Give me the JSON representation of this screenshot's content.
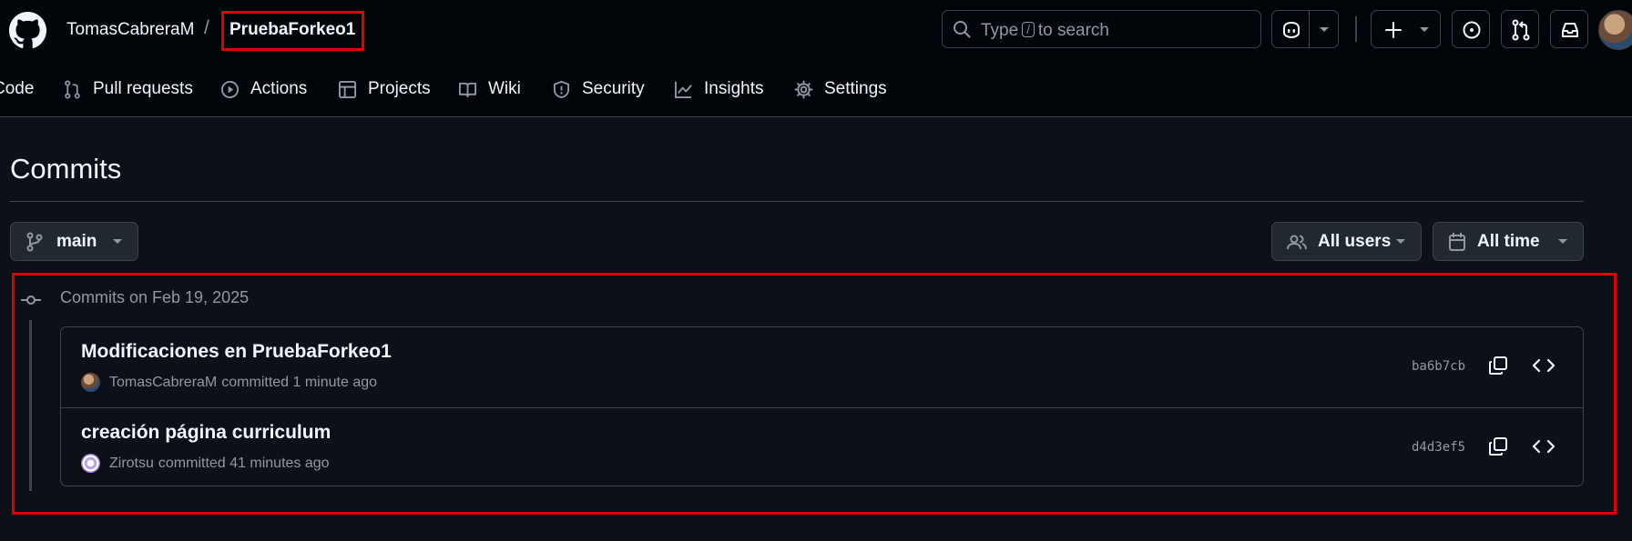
{
  "header": {
    "owner": "TomasCabreraM",
    "separator": "/",
    "repo": "PruebaForkeo1",
    "search": {
      "prefix": "Type",
      "key": "/",
      "suffix": "to search"
    }
  },
  "nav": {
    "code": "Code",
    "pulls": "Pull requests",
    "actions": "Actions",
    "projects": "Projects",
    "wiki": "Wiki",
    "security": "Security",
    "insights": "Insights",
    "settings": "Settings"
  },
  "page": {
    "title": "Commits",
    "branch": "main",
    "users_filter": "All users",
    "time_filter": "All time"
  },
  "commit_group": {
    "title": "Commits on Feb 19, 2025",
    "commits": [
      {
        "message": "Modificaciones en PruebaForkeo1",
        "author": "TomasCabreraM",
        "action": "committed 1 minute ago",
        "sha": "ba6b7cb"
      },
      {
        "message": "creación página curriculum",
        "author": "Zirotsu",
        "action": "committed 41 minutes ago",
        "sha": "d4d3ef5"
      }
    ]
  },
  "colors": {
    "background": "#0d1117",
    "header": "#010409",
    "border": "#3d444d",
    "muted": "#9198a1",
    "highlight": "#e00000"
  }
}
